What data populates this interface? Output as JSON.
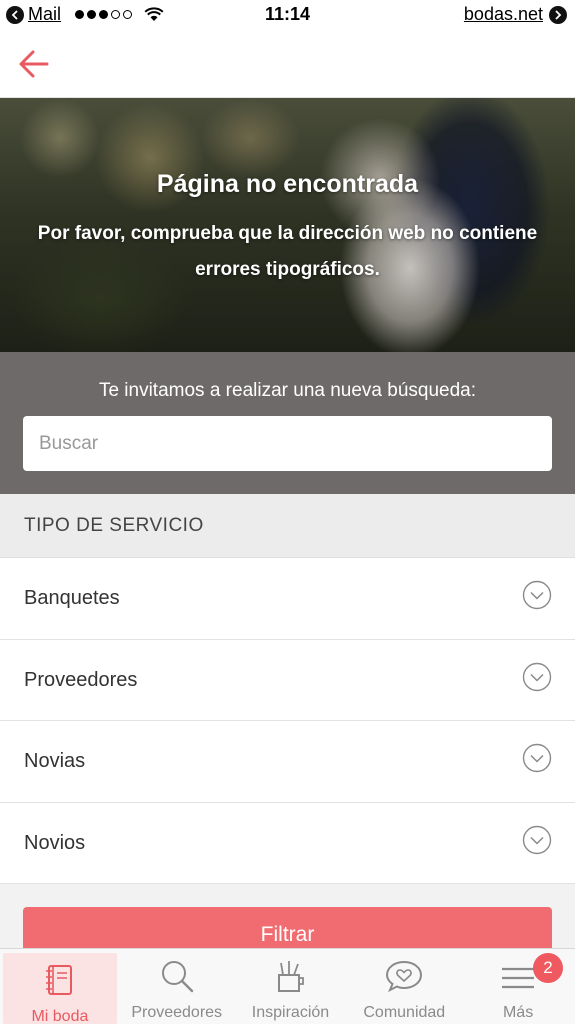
{
  "status_bar": {
    "back_app": "Mail",
    "time": "11:14",
    "site": "bodas.net"
  },
  "nav": {
    "back_icon": "arrow-left-icon",
    "accent_color": "#e85a60"
  },
  "hero": {
    "title": "Página no encontrada",
    "subtitle": "Por favor, comprueba que la dirección web no contiene errores tipográficos."
  },
  "search": {
    "prompt": "Te invitamos a realizar una nueva búsqueda:",
    "placeholder": "Buscar",
    "value": ""
  },
  "service_type": {
    "header": "TIPO DE SERVICIO",
    "items": [
      {
        "label": "Banquetes",
        "icon": "chevron-down-circle-icon"
      },
      {
        "label": "Proveedores",
        "icon": "chevron-down-circle-icon"
      },
      {
        "label": "Novias",
        "icon": "chevron-down-circle-icon"
      },
      {
        "label": "Novios",
        "icon": "chevron-down-circle-icon"
      }
    ]
  },
  "filter": {
    "label": "Filtrar",
    "color": "#f06c70"
  },
  "tab_bar": {
    "tabs": [
      {
        "label": "Mi boda",
        "icon": "notebook-icon",
        "active": true
      },
      {
        "label": "Proveedores",
        "icon": "search-icon",
        "active": false
      },
      {
        "label": "Inspiración",
        "icon": "pencil-cup-icon",
        "active": false
      },
      {
        "label": "Comunidad",
        "icon": "heart-chat-icon",
        "active": false
      },
      {
        "label": "Más",
        "icon": "menu-icon",
        "active": false,
        "badge": "2"
      }
    ]
  }
}
